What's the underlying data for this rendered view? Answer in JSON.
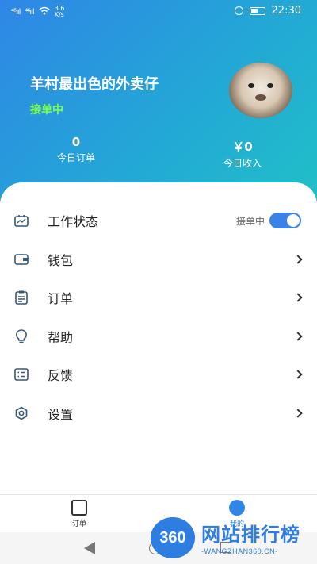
{
  "status_bar": {
    "signal_1": "⁴⁶ııl",
    "signal_2": "⁴⁶ııl",
    "wifi_icon": "wifi-icon",
    "net_speed_value": "3.6",
    "net_speed_unit": "K/s",
    "time": "22:30"
  },
  "profile": {
    "name": "羊村最出色的外卖仔",
    "status": "接单中",
    "avatar_icon": "alpaca-avatar"
  },
  "stats": {
    "orders_value": "0",
    "orders_label": "今日订单",
    "income_value": "￥0",
    "income_label": "今日收入"
  },
  "menu": {
    "items": [
      {
        "label": "工作状态",
        "icon": "work-status-icon"
      },
      {
        "label": "钱包",
        "icon": "wallet-icon"
      },
      {
        "label": "订单",
        "icon": "order-icon"
      },
      {
        "label": "帮助",
        "icon": "help-icon"
      },
      {
        "label": "反馈",
        "icon": "feedback-icon"
      },
      {
        "label": "设置",
        "icon": "settings-icon"
      }
    ],
    "toggle_label": "接单中",
    "toggle_on": true
  },
  "tabbar": {
    "orders_label": "订单",
    "mine_label": "我的"
  },
  "watermark": {
    "logo": "360",
    "title": "网站排行榜",
    "subtitle": "-WANGZHAN360.CN-"
  },
  "colors": {
    "header_start": "#2f86e6",
    "header_end": "#20c0c8",
    "status_green": "#7cff4a",
    "accent": "#3b82e8"
  }
}
